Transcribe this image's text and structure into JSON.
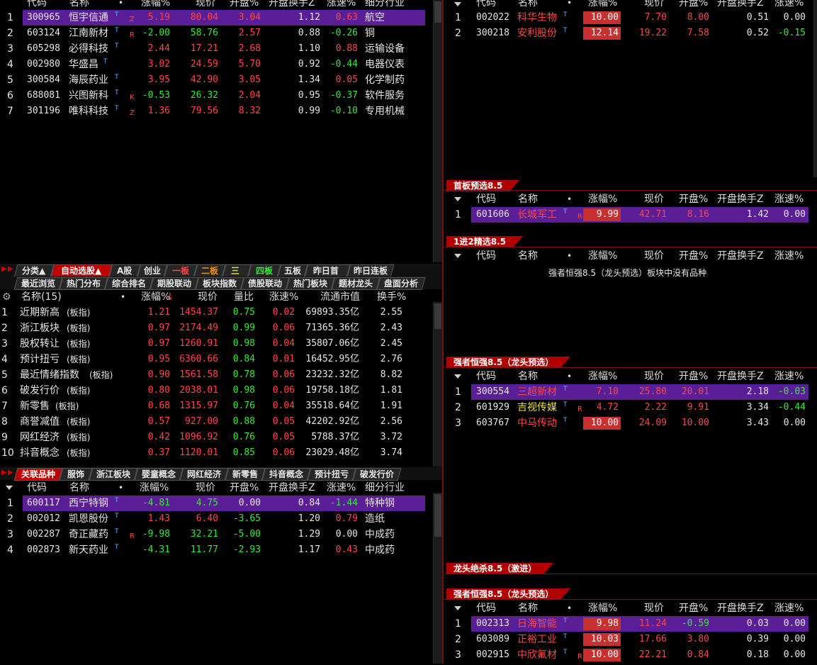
{
  "top_left": {
    "headers": [
      "代码",
      "名称",
      "•",
      "涨幅%",
      "现价",
      "开盘%",
      "开盘换手Z",
      "涨速%",
      "细分行业"
    ],
    "rows": [
      {
        "idx": "1",
        "code": "300965",
        "name": "恒宇信通",
        "tag": "Z",
        "pct": "5.19",
        "price": "80.04",
        "open": "3.04",
        "turn": "1.12",
        "speed": "0.63",
        "industry": "航空"
      },
      {
        "idx": "2",
        "code": "603124",
        "name": "江南新材",
        "tag": "R",
        "pct": "-2.00",
        "price": "58.76",
        "open": "2.57",
        "turn": "0.88",
        "speed": "-0.26",
        "industry": "铜"
      },
      {
        "idx": "3",
        "code": "605298",
        "name": "必得科技",
        "tag": "",
        "pct": "2.44",
        "price": "17.21",
        "open": "2.68",
        "turn": "1.10",
        "speed": "0.88",
        "industry": "运输设备"
      },
      {
        "idx": "4",
        "code": "002980",
        "name": "华盛昌",
        "tag": "",
        "pct": "3.02",
        "price": "24.59",
        "open": "5.70",
        "turn": "0.92",
        "speed": "-0.44",
        "industry": "电器仪表"
      },
      {
        "idx": "5",
        "code": "300584",
        "name": "海辰药业",
        "tag": "",
        "pct": "3.95",
        "price": "42.90",
        "open": "3.05",
        "turn": "1.34",
        "speed": "0.05",
        "industry": "化学制药"
      },
      {
        "idx": "6",
        "code": "688081",
        "name": "兴图新科",
        "tag": "K",
        "pct": "-0.53",
        "price": "26.32",
        "open": "2.04",
        "turn": "0.95",
        "speed": "-0.37",
        "industry": "软件服务"
      },
      {
        "idx": "7",
        "code": "301196",
        "name": "唯科科技",
        "tag": "Z",
        "pct": "1.36",
        "price": "79.56",
        "open": "8.32",
        "turn": "0.99",
        "speed": "-0.10",
        "industry": "专用机械"
      }
    ]
  },
  "tabs_row1": [
    "分类▲",
    "自动选股▲",
    "A股",
    "创业",
    "一板",
    "二板",
    "三板",
    "四板",
    "五板",
    "昨日首板",
    "昨日连板"
  ],
  "tabs_row2": [
    "最近浏览",
    "热门分布",
    "综合排名",
    "期股联动",
    "板块指数",
    "债股联动",
    "热门板块",
    "题材龙头",
    "盘面分析"
  ],
  "sector": {
    "headers": [
      "名称(15)",
      "•",
      "涨幅%",
      "现价",
      "量比",
      "涨速%",
      "流通市值",
      "换手%"
    ],
    "index_tag": "(板指)",
    "rows": [
      {
        "idx": "1",
        "name": "近期新高",
        "pct": "1.21",
        "price": "1454.37",
        "ratio": "0.75",
        "speed": "0.02",
        "cap": "69893.35亿",
        "turn": "2.55"
      },
      {
        "idx": "2",
        "name": "浙江板块",
        "pct": "0.97",
        "price": "2174.49",
        "ratio": "0.99",
        "speed": "0.06",
        "cap": "71365.36亿",
        "turn": "2.43"
      },
      {
        "idx": "3",
        "name": "股权转让",
        "pct": "0.97",
        "price": "1260.91",
        "ratio": "0.98",
        "speed": "0.04",
        "cap": "35807.06亿",
        "turn": "2.45"
      },
      {
        "idx": "4",
        "name": "预计扭亏",
        "pct": "0.95",
        "price": "6360.66",
        "ratio": "0.84",
        "speed": "0.01",
        "cap": "16452.95亿",
        "turn": "2.76"
      },
      {
        "idx": "5",
        "name": "最近情绪指数",
        "pct": "0.90",
        "price": "1561.58",
        "ratio": "0.78",
        "speed": "0.06",
        "cap": "23232.32亿",
        "turn": "8.82"
      },
      {
        "idx": "6",
        "name": "破发行价",
        "pct": "0.80",
        "price": "2038.01",
        "ratio": "0.98",
        "speed": "0.06",
        "cap": "19758.18亿",
        "turn": "1.81"
      },
      {
        "idx": "7",
        "name": "新零售",
        "pct": "0.68",
        "price": "1315.97",
        "ratio": "0.76",
        "speed": "0.04",
        "cap": "35518.64亿",
        "turn": "1.91"
      },
      {
        "idx": "8",
        "name": "商誉减值",
        "pct": "0.57",
        "price": "927.00",
        "ratio": "0.88",
        "speed": "0.05",
        "cap": "42202.92亿",
        "turn": "2.56"
      },
      {
        "idx": "9",
        "name": "网红经济",
        "pct": "0.42",
        "price": "1096.92",
        "ratio": "0.76",
        "speed": "0.05",
        "cap": "5788.37亿",
        "turn": "3.72"
      },
      {
        "idx": "10",
        "name": "抖音概念",
        "pct": "0.37",
        "price": "1120.01",
        "ratio": "0.85",
        "speed": "0.06",
        "cap": "23029.48亿",
        "turn": "3.74"
      }
    ]
  },
  "tabs_row3": [
    "关联品种",
    "服饰",
    "浙江板块",
    "婴童概念",
    "网红经济",
    "新零售",
    "抖音概念",
    "预计扭亏",
    "破发行价"
  ],
  "related": {
    "headers": [
      "代码",
      "名称",
      "•",
      "涨幅%",
      "现价",
      "开盘%",
      "开盘换手Z",
      "涨速%",
      "细分行业"
    ],
    "rows": [
      {
        "idx": "1",
        "code": "600117",
        "name": "西宁特钢",
        "tag": "",
        "pct": "-4.81",
        "price": "4.75",
        "open": "0.00",
        "turn": "0.84",
        "speed": "-1.44",
        "industry": "特种钢"
      },
      {
        "idx": "2",
        "code": "002012",
        "name": "凯恩股份",
        "tag": "",
        "pct": "1.43",
        "price": "6.40",
        "open": "-3.65",
        "turn": "1.20",
        "speed": "0.79",
        "industry": "造纸"
      },
      {
        "idx": "3",
        "code": "002287",
        "name": "奇正藏药",
        "tag": "R",
        "pct": "-9.98",
        "price": "32.21",
        "open": "-5.00",
        "turn": "1.29",
        "speed": "0.00",
        "industry": "中成药"
      },
      {
        "idx": "4",
        "code": "002873",
        "name": "新天药业",
        "tag": "",
        "pct": "-4.31",
        "price": "11.77",
        "open": "-2.93",
        "turn": "1.17",
        "speed": "0.43",
        "industry": "中成药"
      }
    ]
  },
  "right": {
    "headers": [
      "代码",
      "名称",
      "•",
      "涨幅%",
      "现价",
      "开盘%",
      "开盘换手Z",
      "涨速%"
    ],
    "top_rows": [
      {
        "idx": "1",
        "code": "002022",
        "name": "科华生物",
        "tag": "",
        "pct": "10.00",
        "price": "7.70",
        "open": "8.00",
        "turn": "0.51",
        "speed": "0.00"
      },
      {
        "idx": "2",
        "code": "300218",
        "name": "安利股份",
        "tag": "",
        "pct": "12.14",
        "price": "19.22",
        "open": "7.58",
        "turn": "0.52",
        "speed": "-0.15"
      }
    ],
    "sec1_title": "首板预选8.5",
    "sec1_rows": [
      {
        "idx": "1",
        "code": "601606",
        "name": "长城军工",
        "tag": "R",
        "pct": "9.99",
        "price": "42.71",
        "open": "8.16",
        "turn": "1.42",
        "speed": "0.00"
      }
    ],
    "sec2_title": "1进2精选8.5",
    "sec2_empty": "强者恒强8.5（龙头预选）板块中没有品种",
    "sec3_title": "强者恒强8.5（龙头预选）",
    "sec3_rows": [
      {
        "idx": "1",
        "code": "300554",
        "name": "三超新材",
        "tag": "",
        "pct": "7.10",
        "price": "25.80",
        "open": "20.01",
        "turn": "2.18",
        "speed": "-0.03"
      },
      {
        "idx": "2",
        "code": "601929",
        "name": "吉视传媒",
        "tag": "R",
        "pct": "4.72",
        "price": "2.22",
        "open": "9.91",
        "turn": "3.34",
        "speed": "-0.44"
      },
      {
        "idx": "3",
        "code": "603767",
        "name": "中马传动",
        "tag": "",
        "pct": "10.00",
        "price": "24.09",
        "open": "10.00",
        "turn": "3.43",
        "speed": "0.00"
      }
    ],
    "sec4_title": "龙头绝杀8.5（激进）",
    "sec5_title": "强者恒强8.5（龙头预选）",
    "sec5_rows": [
      {
        "idx": "1",
        "code": "002313",
        "name": "日海智能",
        "tag": "",
        "pct": "9.98",
        "price": "11.24",
        "open": "-0.59",
        "turn": "0.03",
        "speed": "0.00"
      },
      {
        "idx": "2",
        "code": "603089",
        "name": "正裕工业",
        "tag": "",
        "pct": "10.03",
        "price": "17.66",
        "open": "3.80",
        "turn": "0.39",
        "speed": "0.00"
      },
      {
        "idx": "3",
        "code": "002915",
        "name": "中欣氟材",
        "tag": "R",
        "pct": "10.00",
        "price": "22.21",
        "open": "0.84",
        "turn": "0.18",
        "speed": "0.00"
      }
    ]
  },
  "colors": {
    "up": "#ff4646",
    "down": "#38e838",
    "selected": "#5a1e96",
    "accent": "#c00000"
  },
  "icons": [
    "gear-icon",
    "chevron-down-icon",
    "arrow-left-icon",
    "arrow-right-icon",
    "t-mark-icon",
    "sort-down-icon"
  ]
}
